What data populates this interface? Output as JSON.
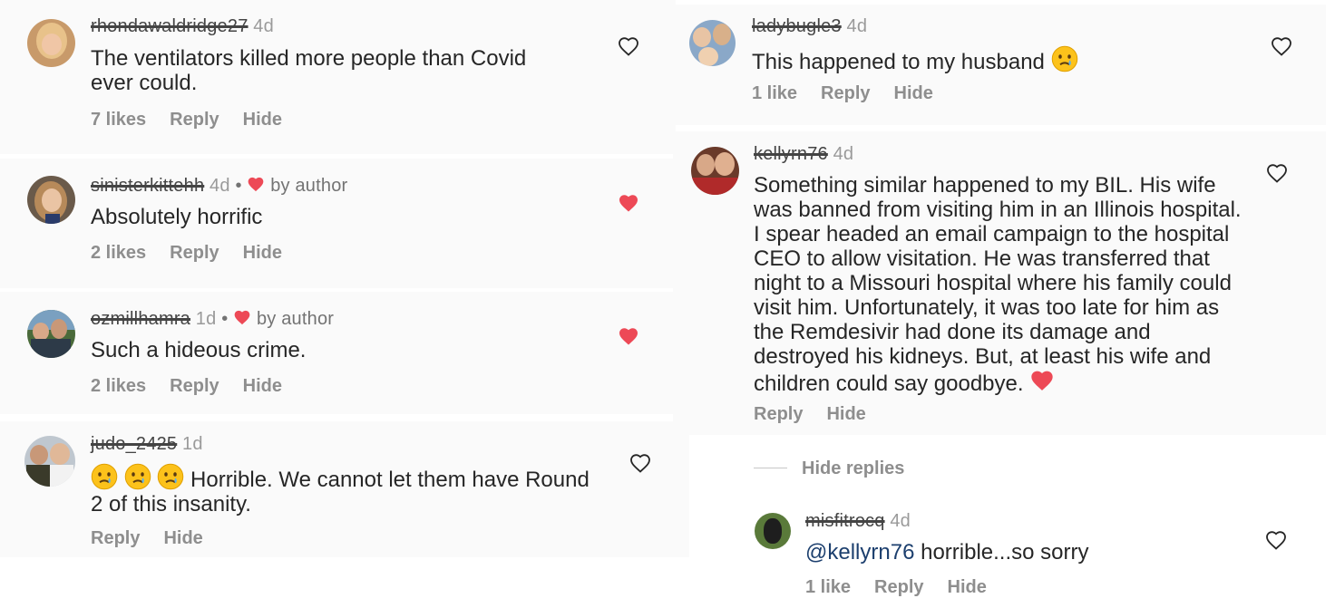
{
  "left_comments": [
    {
      "username": "rhondawaldridge27",
      "age": "4d",
      "text": "The ventilators killed more people than Covid ever could.",
      "likes": "7 likes",
      "reply": "Reply",
      "hide": "Hide"
    },
    {
      "username": "sinisterkittehh",
      "age": "4d",
      "by_author": "by author",
      "text": "Absolutely horrific",
      "likes": "2 likes",
      "reply": "Reply",
      "hide": "Hide"
    },
    {
      "username": "ozmillhamra",
      "age": "1d",
      "by_author": "by author",
      "text": "Such a hideous crime.",
      "likes": "2 likes",
      "reply": "Reply",
      "hide": "Hide"
    },
    {
      "username": "judo_2425",
      "age": "1d",
      "text": "Horrible. We cannot let them have Round 2 of this insanity.",
      "reply": "Reply",
      "hide": "Hide"
    }
  ],
  "right_comments": [
    {
      "username": "ladybugle3",
      "age": "4d",
      "text": "This happened to my husband",
      "likes": "1 like",
      "reply": "Reply",
      "hide": "Hide"
    },
    {
      "username": "kellyrn76",
      "age": "4d",
      "text": "Something similar happened to my BIL. His wife was banned from visiting him in an Illinois hospital. I spear headed an email campaign to the hospital CEO to allow visitation. He was transferred that night to a Missouri hospital where his family could visit him. Unfortunately, it was too late for him as the Remdesivir had done its damage and destroyed his kidneys. But, at least his wife and children could say goodbye.",
      "reply": "Reply",
      "hide": "Hide",
      "hide_replies": "Hide replies"
    },
    {
      "username": "misfitrocq",
      "age": "4d",
      "mention": "@kellyrn76",
      "text": " horrible...so sorry",
      "likes": "1 like",
      "reply": "Reply",
      "hide": "Hide"
    }
  ],
  "colors": {
    "liked_heart": "#ed4956",
    "muted": "#8e8e8e",
    "mention": "#1c3f6e"
  }
}
